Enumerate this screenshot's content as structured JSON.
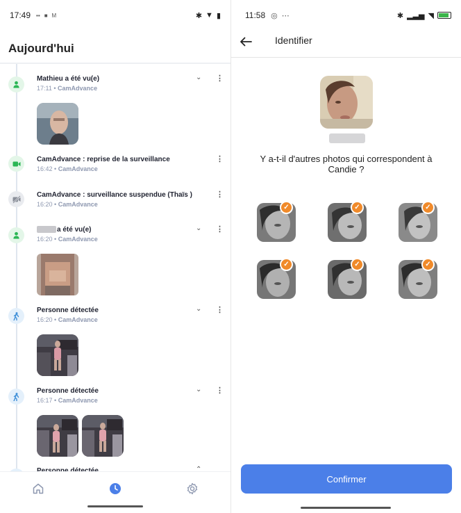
{
  "left": {
    "status": {
      "time": "17:49"
    },
    "title": "Aujourd'hui",
    "events": [
      {
        "title": "Mathieu a été vu(e)",
        "time": "17:11",
        "source": "CamAdvance",
        "icon": "person-icon"
      },
      {
        "title": "CamAdvance : reprise de la surveillance",
        "time": "16:42",
        "source": "CamAdvance",
        "icon": "camera-icon"
      },
      {
        "title": "CamAdvance : surveillance suspendue (Thaïs )",
        "time": "16:20",
        "source": "CamAdvance",
        "icon": "camera-off-icon"
      },
      {
        "title": "a été vu(e)",
        "time": "16:20",
        "source": "CamAdvance",
        "icon": "person-icon"
      },
      {
        "title": "Personne détectée",
        "time": "16:20",
        "source": "CamAdvance",
        "icon": "walking-icon"
      },
      {
        "title": "Personne détectée",
        "time": "16:17",
        "source": "CamAdvance",
        "icon": "walking-icon"
      },
      {
        "title": "Personne détectée",
        "time": "",
        "source": "",
        "icon": "walking-icon"
      }
    ],
    "separator": "•",
    "nav": [
      "home-icon",
      "clock-icon",
      "gear-icon"
    ]
  },
  "right": {
    "status": {
      "time": "11:58"
    },
    "header": {
      "title": "Identifier"
    },
    "question": "Y a-t-il d'autres photos qui correspondent à Candie ?",
    "confirm_label": "Confirmer"
  },
  "colors": {
    "accent": "#4b7fe8",
    "check": "#f08a2a",
    "green": "#2bb655"
  }
}
